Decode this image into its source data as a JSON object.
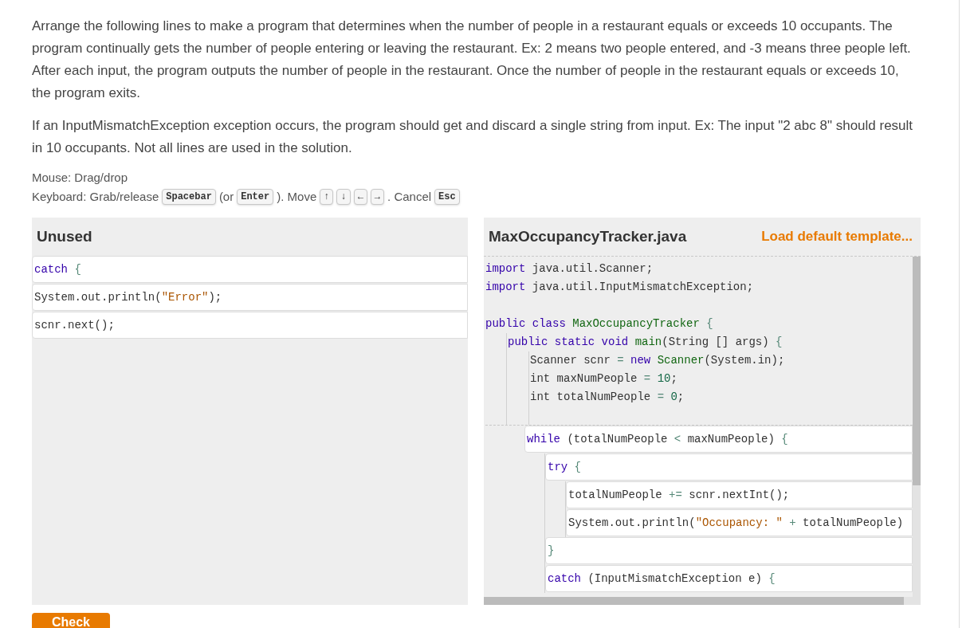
{
  "instructions": [
    "Arrange the following lines to make a program that determines when the number of people in a restaurant equals or exceeds 10 occupants. The program continually gets the number of people entering or leaving the restaurant. Ex: 2 means two people entered, and -3 means three people left. After each input, the program outputs the number of people in the restaurant. Once the number of people in the restaurant equals or exceeds 10, the program exits.",
    "If an InputMismatchException exception occurs, the program should get and discard a single string from input. Ex: The input \"2 abc 8\" should result in 10 occupants. Not all lines are used in the solution."
  ],
  "help": {
    "mouse": "Mouse: Drag/drop",
    "keyboard": [
      {
        "kind": "text",
        "text": "Keyboard: Grab/release"
      },
      {
        "kind": "key",
        "text": "Spacebar"
      },
      {
        "kind": "text",
        "text": "(or"
      },
      {
        "kind": "key",
        "text": "Enter"
      },
      {
        "kind": "text",
        "text": "). Move"
      },
      {
        "kind": "key",
        "text": "↑"
      },
      {
        "kind": "key",
        "text": "↓"
      },
      {
        "kind": "key",
        "text": "←"
      },
      {
        "kind": "key",
        "text": "→"
      },
      {
        "kind": "text",
        "text": ". Cancel"
      },
      {
        "kind": "key",
        "text": "Esc"
      }
    ]
  },
  "unused": {
    "title": "Unused",
    "blocks": [
      {
        "tokens": [
          {
            "kind": "keyword",
            "text": "catch"
          },
          {
            "kind": "operator",
            "text": " {"
          }
        ]
      },
      {
        "tokens": [
          {
            "kind": "plain",
            "text": "System.out.println("
          },
          {
            "kind": "string",
            "text": "\"Error\""
          },
          {
            "kind": "plain",
            "text": ");"
          }
        ]
      },
      {
        "tokens": [
          {
            "kind": "plain",
            "text": "scnr.next();"
          }
        ]
      }
    ]
  },
  "editor": {
    "filename": "MaxOccupancyTracker.java",
    "load_link": "Load default template...",
    "fixed_lines": [
      {
        "kind": "code",
        "tokens": [
          {
            "kind": "keyword",
            "text": "import"
          },
          {
            "kind": "plain",
            "text": " java.util.Scanner;"
          }
        ]
      },
      {
        "kind": "code",
        "tokens": [
          {
            "kind": "keyword",
            "text": "import"
          },
          {
            "kind": "plain",
            "text": " java.util.InputMismatchException;"
          }
        ]
      },
      {
        "kind": "blank"
      },
      {
        "kind": "code",
        "tokens": [
          {
            "kind": "keyword",
            "text": "public class"
          },
          {
            "kind": "def",
            "text": " MaxOccupancyTracker"
          },
          {
            "kind": "operator",
            "text": " {"
          }
        ],
        "children": [
          {
            "kind": "code",
            "tokens": [
              {
                "kind": "keyword",
                "text": "public static void"
              },
              {
                "kind": "def",
                "text": " main"
              },
              {
                "kind": "plain",
                "text": "(String [] args)"
              },
              {
                "kind": "operator",
                "text": " {"
              }
            ],
            "children": [
              {
                "kind": "code",
                "tokens": [
                  {
                    "kind": "plain",
                    "text": "Scanner scnr"
                  },
                  {
                    "kind": "operator",
                    "text": " ="
                  },
                  {
                    "kind": "keyword",
                    "text": " new"
                  },
                  {
                    "kind": "def",
                    "text": " Scanner"
                  },
                  {
                    "kind": "plain",
                    "text": "(System.in);"
                  }
                ]
              },
              {
                "kind": "code",
                "tokens": [
                  {
                    "kind": "plain",
                    "text": "int maxNumPeople"
                  },
                  {
                    "kind": "operator",
                    "text": " ="
                  },
                  {
                    "kind": "number",
                    "text": " 10"
                  },
                  {
                    "kind": "plain",
                    "text": ";"
                  }
                ]
              },
              {
                "kind": "code",
                "tokens": [
                  {
                    "kind": "plain",
                    "text": "int totalNumPeople"
                  },
                  {
                    "kind": "operator",
                    "text": " ="
                  },
                  {
                    "kind": "number",
                    "text": " 0"
                  },
                  {
                    "kind": "plain",
                    "text": ";"
                  }
                ]
              },
              {
                "kind": "blank"
              }
            ]
          }
        ]
      }
    ],
    "blocks": [
      {
        "tokens": [
          {
            "kind": "keyword",
            "text": "while"
          },
          {
            "kind": "plain",
            "text": " (totalNumPeople"
          },
          {
            "kind": "operator",
            "text": " <"
          },
          {
            "kind": "plain",
            "text": " maxNumPeople)"
          },
          {
            "kind": "operator",
            "text": " {"
          }
        ],
        "children": [
          {
            "tokens": [
              {
                "kind": "keyword",
                "text": "try"
              },
              {
                "kind": "operator",
                "text": " {"
              }
            ],
            "children": [
              {
                "tokens": [
                  {
                    "kind": "plain",
                    "text": "totalNumPeople"
                  },
                  {
                    "kind": "operator",
                    "text": " +="
                  },
                  {
                    "kind": "plain",
                    "text": " scnr.nextInt();"
                  }
                ]
              },
              {
                "tokens": [
                  {
                    "kind": "plain",
                    "text": "System.out.println("
                  },
                  {
                    "kind": "string",
                    "text": "\"Occupancy: \""
                  },
                  {
                    "kind": "operator",
                    "text": " +"
                  },
                  {
                    "kind": "plain",
                    "text": " totalNumPeople)"
                  }
                ]
              }
            ]
          },
          {
            "tokens": [
              {
                "kind": "operator",
                "text": "}"
              }
            ]
          },
          {
            "tokens": [
              {
                "kind": "keyword",
                "text": "catch"
              },
              {
                "kind": "plain",
                "text": " (InputMismatchException e)"
              },
              {
                "kind": "operator",
                "text": " {"
              }
            ]
          }
        ]
      }
    ]
  },
  "check_button": "Check"
}
